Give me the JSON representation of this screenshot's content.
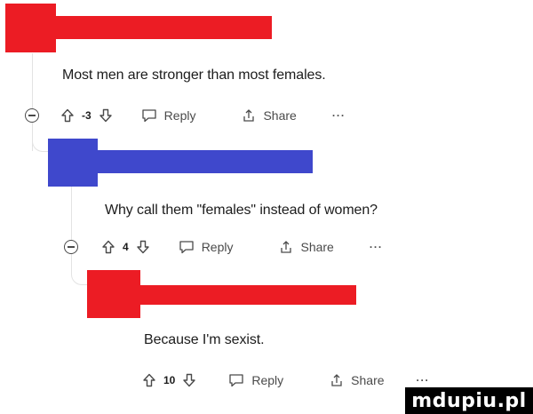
{
  "colors": {
    "redact_red": "#ec1c24",
    "redact_blue": "#3f48cc",
    "thread_line": "#e3e3e3",
    "text": "#1c1c1c",
    "meta": "#4a4a4a"
  },
  "comments": [
    {
      "text": "Most men are stronger than most females.",
      "score": "-3",
      "reply_label": "Reply",
      "share_label": "Share",
      "more_label": "···",
      "redaction_color": "red"
    },
    {
      "text": "Why call them \"females\" instead of women?",
      "score": "4",
      "reply_label": "Reply",
      "share_label": "Share",
      "more_label": "···",
      "redaction_color": "blue"
    },
    {
      "text": "Because I'm sexist.",
      "score": "10",
      "reply_label": "Reply",
      "share_label": "Share",
      "more_label": "···",
      "redaction_color": "red"
    }
  ],
  "icons": [
    "collapse-icon",
    "upvote-icon",
    "downvote-icon",
    "reply-icon",
    "share-icon",
    "more-icon"
  ],
  "watermark": "mdupiu.pl"
}
